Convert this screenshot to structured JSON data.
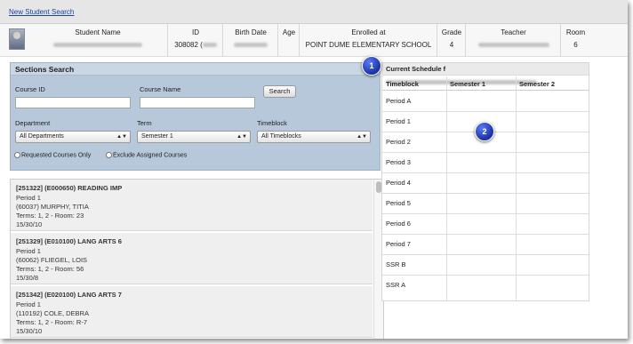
{
  "topbar": {
    "new_search_link": "New Student Search"
  },
  "student_header": {
    "columns": [
      {
        "label": "Student Name",
        "value": ""
      },
      {
        "label": "ID",
        "value": "308082 ("
      },
      {
        "label": "Birth Date",
        "value": ""
      },
      {
        "label": "Age",
        "value": ""
      },
      {
        "label": "Enrolled at",
        "value": "POINT DUME ELEMENTARY SCHOOL"
      },
      {
        "label": "Grade",
        "value": "4"
      },
      {
        "label": "Teacher",
        "value": ""
      },
      {
        "label": "Room",
        "value": "6"
      }
    ]
  },
  "sections_search": {
    "title": "Sections Search",
    "course_id_label": "Course ID",
    "course_id_value": "",
    "course_name_label": "Course Name",
    "course_name_value": "",
    "search_button": "Search",
    "department_label": "Department",
    "department_value": "All Departments",
    "term_label": "Term",
    "term_value": "Semester 1",
    "timeblock_label": "Timeblock",
    "timeblock_value": "All Timeblocks",
    "requested_only_label": "Requested Courses Only",
    "exclude_assigned_label": "Exclude Assigned Courses"
  },
  "results": [
    {
      "title": "[251322] (E000650) READING IMP",
      "period": "Period 1",
      "teacher": "(60037) MURPHY, TITIA",
      "terms": "Terms: 1, 2 - Room: 23",
      "counts": "15/30/10"
    },
    {
      "title": "[251329] (E010100) LANG ARTS 6",
      "period": "Period 1",
      "teacher": "(60062) FLIEGEL, LOIS",
      "terms": "Terms: 1, 2 - Room: 56",
      "counts": "15/30/8"
    },
    {
      "title": "[251342] (E020100) LANG ARTS 7",
      "period": "Period 1",
      "teacher": "(110192) COLE, DEBRA",
      "terms": "Terms: 1, 2 - Room: R-7",
      "counts": "15/30/10"
    }
  ],
  "schedule": {
    "title": "Current Schedule f",
    "headers": [
      "Timeblock",
      "Semester 1",
      "Semester 2"
    ],
    "rows": [
      "Period A",
      "Period 1",
      "Period 2",
      "Period 3",
      "Period 4",
      "Period 5",
      "Period 6",
      "Period 7",
      "SSR B",
      "SSR A"
    ]
  },
  "callouts": [
    "1",
    "2"
  ],
  "colors": {
    "search_panel": "#b6c8d9",
    "callout": "#1b2fa8",
    "link": "#1a44a8"
  }
}
